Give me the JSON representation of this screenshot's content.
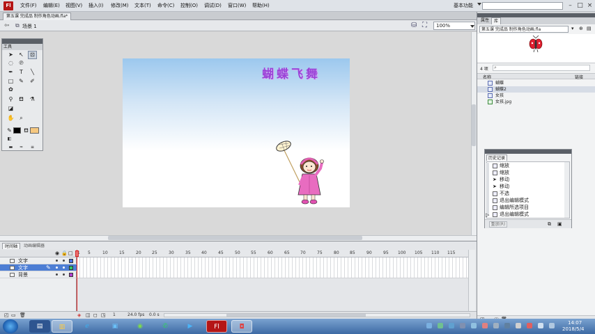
{
  "app": {
    "logo": "Fl",
    "menu": [
      "文件(F)",
      "编辑(E)",
      "视图(V)",
      "插入(I)",
      "修改(M)",
      "文本(T)",
      "命令(C)",
      "控制(O)",
      "调试(D)",
      "窗口(W)",
      "帮助(H)"
    ],
    "workspace": "基本功能"
  },
  "document": {
    "tab_title": "第五课 完成品 制作角色动画.fla*",
    "scene": "场景 1",
    "zoom": "100%"
  },
  "stage": {
    "title_text": "蝴蝶飞舞"
  },
  "tools": {
    "title": "工具",
    "icons": [
      "selection-tool-icon",
      "subselection-tool-icon",
      "free-transform-icon",
      "lasso-icon",
      "pen-icon",
      "text-tool-icon",
      "line-tool-icon",
      "rectangle-tool-icon",
      "pencil-icon",
      "brush-icon",
      "deco-icon",
      "bone-icon",
      "paint-bucket-icon",
      "eyedropper-icon",
      "eraser-icon",
      "hand-icon",
      "zoom-icon"
    ],
    "stroke_color": "#000000",
    "fill_color": "#f6c880"
  },
  "timeline": {
    "tabs": [
      "时间轴",
      "动画编辑器"
    ],
    "layers": [
      {
        "name": "文字",
        "color": "#4d72e0",
        "selected": false
      },
      {
        "name": "文字",
        "color": "#2ec46a",
        "selected": true
      },
      {
        "name": "背景",
        "color": "#b040d0",
        "selected": false
      }
    ],
    "frame_numbers": [
      "1",
      "5",
      "10",
      "15",
      "20",
      "25",
      "30",
      "35",
      "40",
      "45",
      "50",
      "55",
      "60",
      "65",
      "70",
      "75",
      "80",
      "85",
      "90",
      "95",
      "100",
      "105",
      "110",
      "115"
    ],
    "current_frame": "1",
    "fps": "24.0 fps",
    "time": "0.0 s"
  },
  "panels": {
    "tabs": [
      "属性",
      "库"
    ],
    "library_doc": "第五课 完成品 制作角色动画.fla",
    "item_count": "4 项",
    "columns": {
      "name": "名称",
      "linkage": "链接"
    },
    "items": [
      {
        "name": "蝴蝶",
        "selected": false
      },
      {
        "name": "蝴蝶2",
        "selected": true
      },
      {
        "name": "女孩",
        "selected": false
      },
      {
        "name": "女孩.jpg",
        "selected": false
      }
    ]
  },
  "history": {
    "title": "历史记录",
    "items": [
      "缩放",
      "缩放",
      "移动",
      "移动",
      "不选",
      "退出编辑模式",
      "编辑所选项目",
      "退出编辑模式"
    ],
    "replay": "重放(R)"
  },
  "taskbar": {
    "time": "14:07",
    "date": "2018/5/4",
    "apps": [
      "explorer-icon",
      "library-icon",
      "ie-icon",
      "media-icon",
      "refresh-icon",
      "wechat-icon",
      "video-icon",
      "flash-icon",
      "recorder-icon"
    ]
  }
}
